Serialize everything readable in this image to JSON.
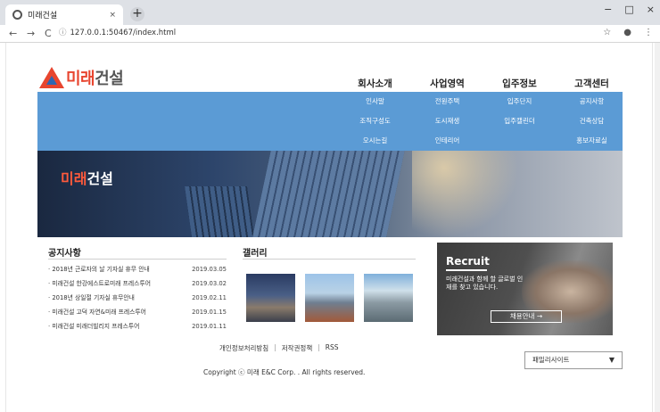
{
  "browser": {
    "tab_title": "미래건설",
    "tab_close": "×",
    "new_tab": "+",
    "url": "127.0.0.1:50467/index.html",
    "window_buttons": [
      "−",
      "□",
      "×"
    ],
    "nav": {
      "back": "←",
      "forward": "→",
      "reload": "C"
    },
    "toolbar_icons": {
      "star": "☆",
      "account": "●",
      "menu": "⋮"
    }
  },
  "site": {
    "logo_text_red": "미래",
    "logo_text_gray": "건설",
    "gnb": [
      "회사소개",
      "사업영역",
      "입주정보",
      "고객센터"
    ],
    "submenu": [
      [
        "인사말",
        "조직구성도",
        "오시는길"
      ],
      [
        "전원주택",
        "도시재생",
        "인테리어"
      ],
      [
        "입주단지",
        "입주캘린더"
      ],
      [
        "공지사항",
        "건축상담",
        "홍보자료실"
      ]
    ],
    "hero_title_red": "미래",
    "hero_title_white": "건설"
  },
  "notice": {
    "title": "공지사항",
    "items": [
      {
        "text": "· 2018년 근로자의 날 기자실 휴무 안내",
        "date": "2019.03.05"
      },
      {
        "text": "· 미래건설 한강에스트로미래 프레스투어",
        "date": "2019.03.02"
      },
      {
        "text": "· 2018년 상일절 기자실 휴무안내",
        "date": "2019.02.11"
      },
      {
        "text": "· 미래건설 고덕 자연&미래 프레스투어",
        "date": "2019.01.15"
      },
      {
        "text": "· 미래건설 미래더빌리지 프레스투어",
        "date": "2019.01.11"
      }
    ]
  },
  "gallery": {
    "title": "갤러리"
  },
  "recruit": {
    "title": "Recruit",
    "desc": "미래건설과 함께 할 글로벌 인재를 찾고 있습니다.",
    "button": "채용안내 →"
  },
  "footer": {
    "links": [
      "개인정보처리방침",
      "저작권정책",
      "RSS"
    ],
    "separator": "|",
    "copyright": "Copyright ⓒ 미래 E&C Corp. . All rights reserved.",
    "family_site": "패밀리사이트",
    "family_caret": "▼"
  }
}
